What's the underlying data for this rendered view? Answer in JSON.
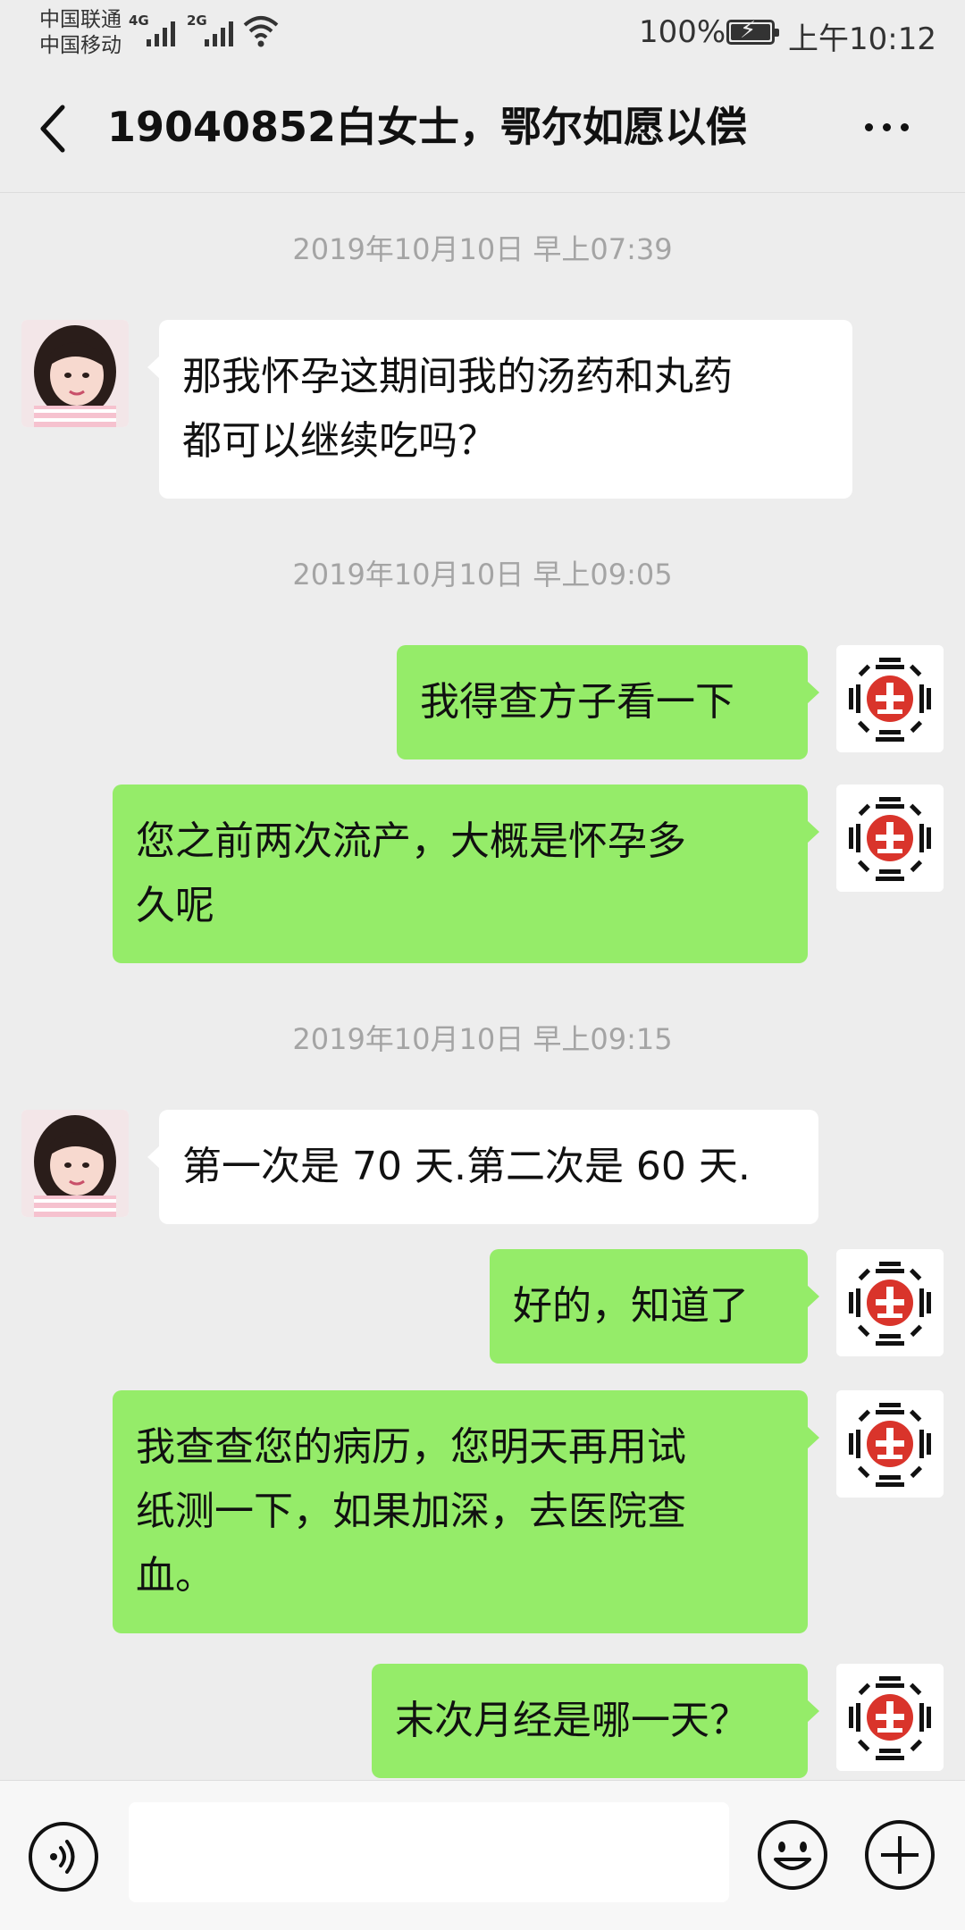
{
  "status_bar": {
    "carrier_1": "中国联通",
    "carrier_2": "中国移动",
    "network_1": "4G",
    "network_2": "2G",
    "battery": "100%",
    "time": "上午10:12"
  },
  "header": {
    "back_icon": "chevron-left-icon",
    "title": "19040852白女士，鄂尔如愿以偿",
    "more_icon": "more-dots-icon"
  },
  "messages": [
    {
      "type": "timestamp",
      "text": "2019年10月10日 早上07:39"
    },
    {
      "type": "message",
      "side": "left",
      "lines": [
        "那我怀孕这期间我的汤药和丸药",
        "都可以继续吃吗？"
      ]
    },
    {
      "type": "timestamp",
      "text": "2019年10月10日 早上09:05"
    },
    {
      "type": "message",
      "side": "right",
      "lines": [
        "我得查方子看一下"
      ]
    },
    {
      "type": "message",
      "side": "right",
      "lines": [
        "您之前两次流产，大概是怀孕多",
        "久呢"
      ]
    },
    {
      "type": "timestamp",
      "text": "2019年10月10日 早上09:15"
    },
    {
      "type": "message",
      "side": "left",
      "lines": [
        "第一次是 70 天.第二次是 60 天."
      ]
    },
    {
      "type": "message",
      "side": "right",
      "lines": [
        "好的，知道了"
      ]
    },
    {
      "type": "message",
      "side": "right",
      "lines": [
        "我查查您的病历，您明天再用试",
        "纸测一下，如果加深，去医院查",
        "血。"
      ]
    },
    {
      "type": "message",
      "side": "right",
      "lines": [
        "末次月经是哪一天？"
      ]
    }
  ],
  "input_bar": {
    "voice_icon": "voice-icon",
    "input_value": "",
    "emoji_icon": "emoji-icon",
    "plus_icon": "plus-icon"
  },
  "colors": {
    "background": "#ededed",
    "bubble_self": "#95ec69",
    "bubble_other": "#ffffff",
    "timestamp_text": "#a4a4a4",
    "logo_red": "#d9342b"
  }
}
